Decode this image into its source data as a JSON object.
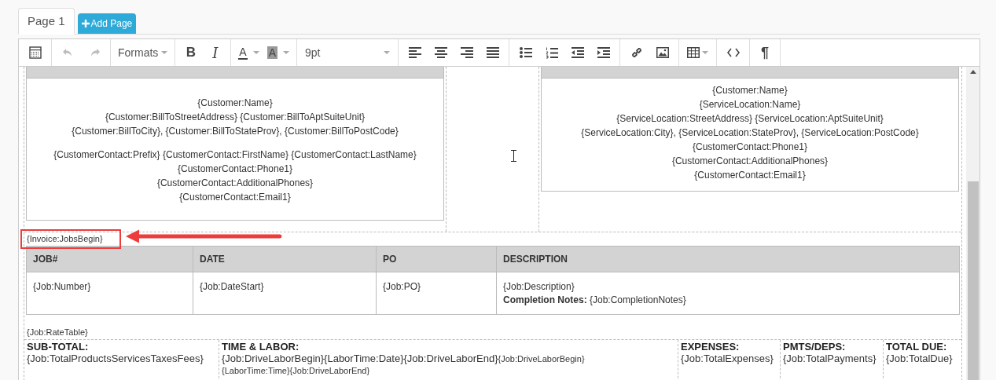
{
  "tabs": [
    {
      "label": "Page 1",
      "selected": true
    }
  ],
  "add_page_button": {
    "label": "Add Page"
  },
  "toolbar": {
    "groups": [
      [
        {
          "kind": "template"
        }
      ],
      [
        {
          "kind": "undo",
          "disabled": true
        },
        {
          "kind": "redo",
          "disabled": true
        }
      ],
      [
        {
          "kind": "formats",
          "label": "Formats"
        }
      ],
      [
        {
          "kind": "bold",
          "label": "B"
        },
        {
          "kind": "italic",
          "label": "I"
        }
      ],
      [
        {
          "kind": "text_color",
          "label": "A"
        },
        {
          "kind": "background_color",
          "label": "A"
        }
      ],
      [
        {
          "kind": "font_size",
          "label": "9pt"
        }
      ],
      [
        {
          "kind": "align_left"
        },
        {
          "kind": "align_center"
        },
        {
          "kind": "align_right"
        },
        {
          "kind": "justify"
        }
      ],
      [
        {
          "kind": "bullet_list"
        },
        {
          "kind": "numbered_list"
        },
        {
          "kind": "outdent"
        },
        {
          "kind": "indent"
        }
      ],
      [
        {
          "kind": "link"
        },
        {
          "kind": "image"
        }
      ],
      [
        {
          "kind": "table"
        }
      ],
      [
        {
          "kind": "source_code"
        }
      ],
      [
        {
          "kind": "paragraph_marks",
          "label": "¶"
        }
      ]
    ]
  },
  "document": {
    "bill_to": {
      "paragraphs": [
        [
          "{Customer:Name}",
          "{Customer:BillToStreetAddress} {Customer:BillToAptSuiteUnit}",
          "{Customer:BillToCity}, {Customer:BillToStateProv}, {Customer:BillToPostCode}"
        ],
        [
          "{CustomerContact:Prefix} {CustomerContact:FirstName} {CustomerContact:LastName}",
          "{CustomerContact:Phone1}",
          "{CustomerContact:AdditionalPhones}",
          "{CustomerContact:Email1}"
        ]
      ]
    },
    "service_location": {
      "paragraphs": [
        [
          "{Customer:Name}",
          "{ServiceLocation:Name}",
          "{ServiceLocation:StreetAddress} {ServiceLocation:AptSuiteUnit}",
          "{ServiceLocation:City}, {ServiceLocation:StateProv}, {ServiceLocation:PostCode}",
          "{CustomerContact:Phone1}",
          "{CustomerContact:AdditionalPhones}",
          "{CustomerContact:Email1}"
        ]
      ]
    },
    "jobs_marker": {
      "text": "{Invoice:JobsBegin}",
      "highlighted": true
    },
    "jobs_table": {
      "columns": [
        "JOB#",
        "DATE",
        "PO",
        "DESCRIPTION"
      ],
      "rows": [
        [
          [
            "{Job:Number}"
          ],
          [
            "{Job:DateStart}"
          ],
          [
            "{Job:PO}"
          ],
          [
            "{Job:Description}",
            "**Completion Notes:** {Job:CompletionNotes}"
          ]
        ]
      ]
    },
    "rate_table": "{Job:RateTable}",
    "totals": [
      {
        "heading": "SUB-TOTAL:",
        "lines": [
          [
            {
              "kind": "large",
              "text": "{Job:TotalProductsServicesTaxesFees}"
            }
          ]
        ]
      },
      {
        "heading": "TIME & LABOR:",
        "lines": [
          [
            {
              "kind": "large",
              "text": "{Job:DriveLaborBegin}{LaborTime:Date}{Job:DriveLaborEnd}"
            },
            {
              "kind": "small",
              "text": "{Job:DriveLaborBegin}"
            }
          ],
          [
            {
              "kind": "small",
              "text": "{LaborTime:Time}{Job:DriveLaborEnd}"
            }
          ]
        ]
      },
      {
        "heading": "EXPENSES:",
        "lines": [
          [
            {
              "kind": "large",
              "text": "{Job:TotalExpenses}"
            }
          ]
        ]
      },
      {
        "heading": "PMTS/DEPS:",
        "lines": [
          [
            {
              "kind": "large",
              "text": "{Job:TotalPayments}"
            }
          ]
        ]
      },
      {
        "heading": "TOTAL DUE:",
        "lines": [
          [
            {
              "kind": "large",
              "text": "{Job:TotalDue}"
            }
          ]
        ]
      }
    ]
  }
}
